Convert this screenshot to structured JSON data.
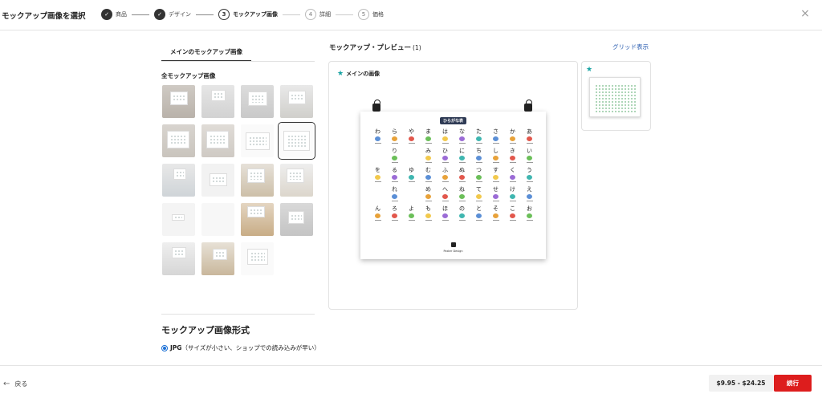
{
  "header": {
    "title": "モックアップ画像を選択",
    "steps": [
      {
        "number": "1",
        "label": "商品",
        "state": "done"
      },
      {
        "number": "2",
        "label": "デザイン",
        "state": "done"
      },
      {
        "number": "3",
        "label": "モックアップ画像",
        "state": "current"
      },
      {
        "number": "4",
        "label": "詳細",
        "state": "pending"
      },
      {
        "number": "5",
        "label": "価格",
        "state": "pending"
      }
    ],
    "close_icon": "close-icon",
    "close_glyph": "×",
    "check_glyph": "✓"
  },
  "left": {
    "tab_label": "メインのモックアップ画像",
    "all_heading": "全モックアップ画像",
    "format_heading": "モックアップ画像形式",
    "format_option_bold": "JPG",
    "format_option_rest": "（サイズが小さい、ショップでの読み込みが早い）",
    "thumbnails": [
      {
        "scene": "wall-plant",
        "selected": false
      },
      {
        "scene": "wall-grey",
        "selected": false
      },
      {
        "scene": "stone-wall",
        "selected": false
      },
      {
        "scene": "desk-lamp",
        "selected": false
      },
      {
        "scene": "hand-hold",
        "selected": false
      },
      {
        "scene": "hand-hold-2",
        "selected": false
      },
      {
        "scene": "flat-white",
        "selected": false
      },
      {
        "scene": "clips-white",
        "selected": true
      },
      {
        "scene": "bedroom",
        "selected": false
      },
      {
        "scene": "person-hold",
        "selected": false
      },
      {
        "scene": "shelf",
        "selected": false
      },
      {
        "scene": "flowers",
        "selected": false
      },
      {
        "scene": "person-stand",
        "selected": false
      },
      {
        "scene": "blank",
        "selected": false
      },
      {
        "scene": "tubes",
        "selected": false
      },
      {
        "scene": "paper-flat",
        "selected": false
      },
      {
        "scene": "living-room",
        "selected": false
      },
      {
        "scene": "curtain-room",
        "selected": false
      },
      {
        "scene": "frame-white",
        "selected": false
      }
    ]
  },
  "preview": {
    "heading": "モックアップ・プレビュー",
    "count": "(1)",
    "grid_link": "グリッド表示",
    "main_label": "メインの画像",
    "star_icon": "star-icon",
    "star_glyph": "★",
    "poster": {
      "title": "ひらがな表",
      "brand": "Poster Design",
      "kana_rows": [
        [
          "わ",
          "ら",
          "や",
          "ま",
          "は",
          "な",
          "た",
          "さ",
          "か",
          "あ"
        ],
        [
          "",
          "り",
          "",
          "み",
          "ひ",
          "に",
          "ち",
          "し",
          "き",
          "い"
        ],
        [
          "を",
          "る",
          "ゆ",
          "む",
          "ふ",
          "ぬ",
          "つ",
          "す",
          "く",
          "う"
        ],
        [
          "",
          "れ",
          "",
          "め",
          "へ",
          "ね",
          "て",
          "せ",
          "け",
          "え"
        ],
        [
          "ん",
          "ろ",
          "よ",
          "も",
          "ほ",
          "の",
          "と",
          "そ",
          "こ",
          "お"
        ]
      ],
      "dot_colors": [
        "#5b8fd6",
        "#e8a23a",
        "#e2574c",
        "#6bbf59",
        "#f2c94c",
        "#9b6bd6",
        "#3fb6b0"
      ]
    }
  },
  "footer": {
    "back_label": "戻る",
    "back_glyph": "←",
    "price": "$9.95 - $24.25",
    "continue_label": "続行"
  }
}
